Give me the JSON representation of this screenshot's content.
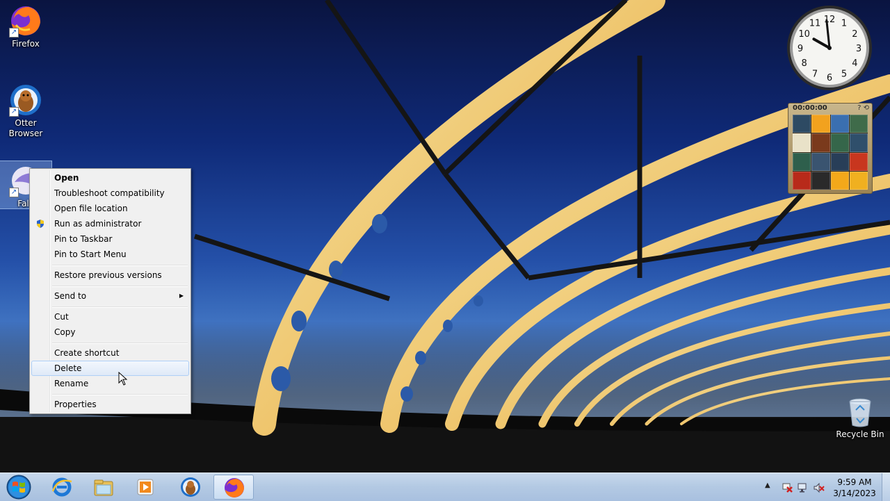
{
  "desktop": {
    "icons": [
      {
        "label": "Firefox",
        "icon": "firefox-icon"
      },
      {
        "label": "Otter Browser",
        "icon": "otter-browser-icon"
      },
      {
        "label": "Falk",
        "icon": "falkon-icon"
      },
      {
        "label": "Recycle Bin",
        "icon": "recycle-bin-icon"
      }
    ]
  },
  "context_menu": {
    "items": [
      {
        "label": "Open"
      },
      {
        "label": "Troubleshoot compatibility"
      },
      {
        "label": "Open file location"
      },
      {
        "label": "Run as administrator",
        "icon": "uac-shield-icon"
      },
      {
        "label": "Pin to Taskbar"
      },
      {
        "label": "Pin to Start Menu"
      },
      {
        "label": "Restore previous versions"
      },
      {
        "label": "Send to"
      },
      {
        "label": "Cut"
      },
      {
        "label": "Copy"
      },
      {
        "label": "Create shortcut"
      },
      {
        "label": "Delete"
      },
      {
        "label": "Rename"
      },
      {
        "label": "Properties"
      }
    ],
    "hovered": "Delete"
  },
  "clock_gadget": {
    "numbers": [
      "12",
      "1",
      "2",
      "3",
      "4",
      "5",
      "6",
      "7",
      "8",
      "9",
      "10",
      "11"
    ],
    "hour": 9,
    "minute": 59
  },
  "puzzle_gadget": {
    "timer": "00:00:00",
    "tile_colors": [
      "#2d4a63",
      "#f2a21e",
      "#3a6fb0",
      "#3f6b4a",
      "#e9e2c8",
      "#7a3a1c",
      "#35664a",
      "#2f4f6b",
      "#2e5f4c",
      "#3a5470",
      "#283e58",
      "#c8361e",
      "#b82a1a",
      "#2a2a2a",
      "#f3a81a",
      "#f0b020"
    ]
  },
  "taskbar": {
    "pinned": [
      {
        "name": "internet-explorer-icon"
      },
      {
        "name": "windows-explorer-icon"
      },
      {
        "name": "media-player-icon"
      },
      {
        "name": "otter-browser-icon"
      },
      {
        "name": "firefox-icon",
        "active": true
      }
    ],
    "tray_icons": [
      "show-hidden-icons-icon",
      "action-center-icon",
      "network-icon",
      "volume-muted-icon"
    ],
    "time": "9:59 AM",
    "date": "3/14/2023"
  }
}
